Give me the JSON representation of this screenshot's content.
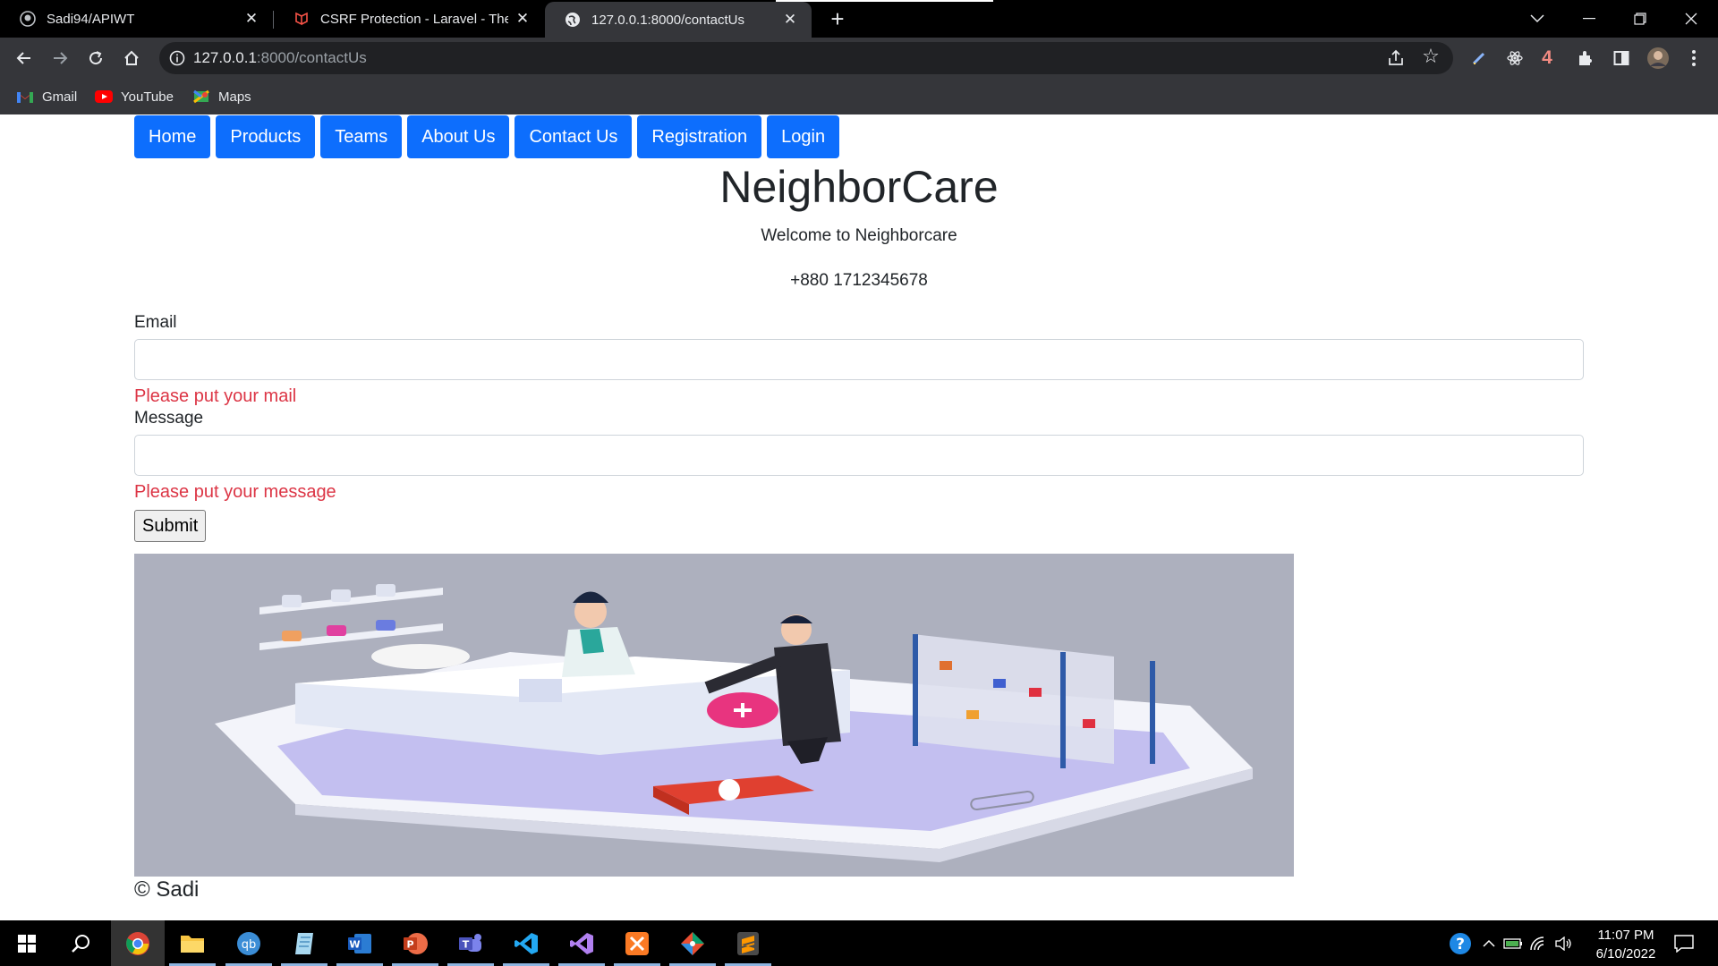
{
  "browser": {
    "tabs": [
      {
        "title": "Sadi94/APIWT",
        "favicon": "github-icon",
        "active": false
      },
      {
        "title": "CSRF Protection - Laravel - The P",
        "favicon": "laravel-icon",
        "active": false
      },
      {
        "title": "127.0.0.1:8000/contactUs",
        "favicon": "globe-icon",
        "active": true
      }
    ],
    "url_host": "127.0.0.1",
    "url_rest": ":8000/contactUs",
    "extension_badge": "4",
    "bookmarks": [
      {
        "label": "Gmail",
        "icon": "gmail-icon"
      },
      {
        "label": "YouTube",
        "icon": "youtube-icon"
      },
      {
        "label": "Maps",
        "icon": "maps-icon"
      }
    ]
  },
  "nav": {
    "items": [
      "Home",
      "Products",
      "Teams",
      "About Us",
      "Contact Us",
      "Registration",
      "Login"
    ]
  },
  "header": {
    "title": "NeighborCare",
    "welcome": "Welcome to Neighborcare",
    "phone": "+880 1712345678"
  },
  "form": {
    "email_label": "Email",
    "email_value": "",
    "email_error": "Please put your mail",
    "message_label": "Message",
    "message_value": "",
    "message_error": "Please put your message",
    "submit_label": "Submit"
  },
  "footer": {
    "copyright": "© Sadi"
  },
  "taskbar": {
    "time": "11:07 PM",
    "date": "6/10/2022",
    "apps": [
      "chrome-icon",
      "file-explorer-icon",
      "qbittorrent-icon",
      "notepad-icon",
      "word-icon",
      "powerpoint-icon",
      "teams-icon",
      "vscode-icon",
      "visual-studio-icon",
      "xampp-icon",
      "git-icon",
      "sublime-icon"
    ]
  },
  "colors": {
    "primary": "#0d6efd",
    "error": "#dc3545",
    "illustration_bg": "#adb0be"
  }
}
